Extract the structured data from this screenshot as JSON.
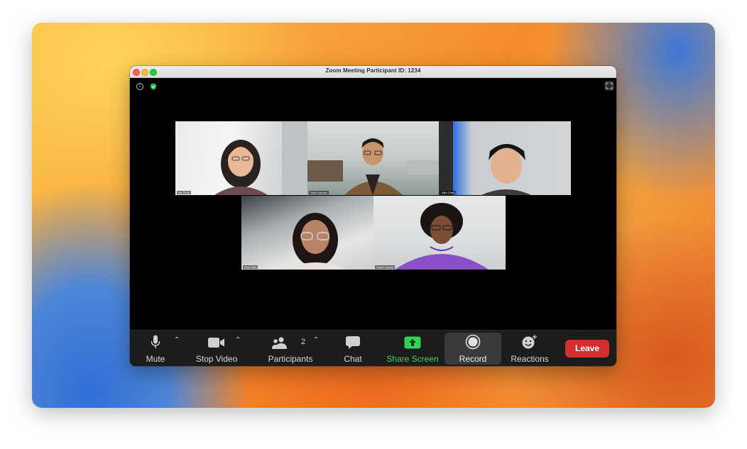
{
  "window": {
    "title": "Zoom Meeting Participant ID: 1234"
  },
  "participants": [
    {
      "name": "Iris Chen"
    },
    {
      "name": "Sahil Karnani"
    },
    {
      "name": "Alex Chen"
    },
    {
      "name": "Aria Patel"
    },
    {
      "name": "Daniel Kumar"
    }
  ],
  "toolbar": {
    "mute_label": "Mute",
    "stop_video_label": "Stop Video",
    "participants_label": "Participants",
    "participants_count": "2",
    "chat_label": "Chat",
    "share_label": "Share Screen",
    "record_label": "Record",
    "reactions_label": "Reactions",
    "leave_label": "Leave"
  },
  "colors": {
    "share_green": "#3ed45c",
    "leave_red": "#d32f2f",
    "toolbar_bg": "#1c1c1c"
  },
  "icons": {
    "info": "info-icon",
    "security": "shield-icon",
    "fullscreen": "fullscreen-icon",
    "mute": "microphone-icon",
    "video": "video-camera-icon",
    "participants": "people-icon",
    "chat": "chat-bubble-icon",
    "share": "share-up-arrow-icon",
    "record": "record-circle-icon",
    "reactions": "smiley-plus-icon"
  }
}
